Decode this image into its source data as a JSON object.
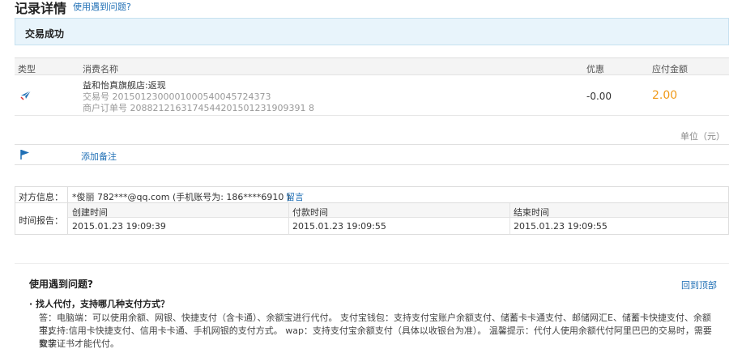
{
  "page": {
    "title": "记录详情",
    "help_link": "使用遇到问题?"
  },
  "status": {
    "text": "交易成功"
  },
  "table": {
    "headers": {
      "type": "类型",
      "name": "消费名称",
      "discount": "优惠",
      "amount": "应付金额"
    },
    "row": {
      "icon": "paper-plane-icon",
      "name": "益和怡真旗舰店:返现",
      "trade_no": "交易号 2015012300001000540045724373",
      "order_no": "商户订单号 2088212163174544201501231909391 8",
      "discount": "-0.00",
      "amount": "2.00"
    },
    "unit": "单位（元）"
  },
  "remark": {
    "icon": "flag-icon",
    "label": "添加备注"
  },
  "info": {
    "counterparty_label": "对方信息：",
    "counterparty_value": "*俊丽 782***@qq.com (手机账号为: 186****6910 )",
    "message_link": "留言",
    "time_label": "时间报告：",
    "times": [
      {
        "label": "创建时间",
        "value": "2015.01.23 19:09:39"
      },
      {
        "label": "付款时间",
        "value": "2015.01.23 19:09:55"
      },
      {
        "label": "结束时间",
        "value": "2015.01.23 19:09:55"
      }
    ]
  },
  "faq": {
    "title": "使用遇到问题?",
    "back_top": "回到顶部",
    "q1": "· 找人代付，支持哪几种支付方式？",
    "a1_line1": "答：电脑端：可以使用余额、网银、快捷支付（含卡通）、余额宝进行代付。 支付宝钱包：支持支付宝账户余额支付、储蓄卡卡通支付、邮储网汇E、储蓄卡快捷支付、余额宝；",
    "a1_line2": "不支持:信用卡快捷支付、信用卡卡通、手机网银的支付方式。 wap：支持支付宝余额支付（具体以收银台为准）。 温馨提示：代付人使用余额代付阿里巴巴的交易时，需要安装",
    "a1_line3": "数字证书才能代付。"
  },
  "colors": {
    "accent": "#1f6fb5",
    "amount": "#f09a1a",
    "status_bg": "#e8f4fb"
  }
}
